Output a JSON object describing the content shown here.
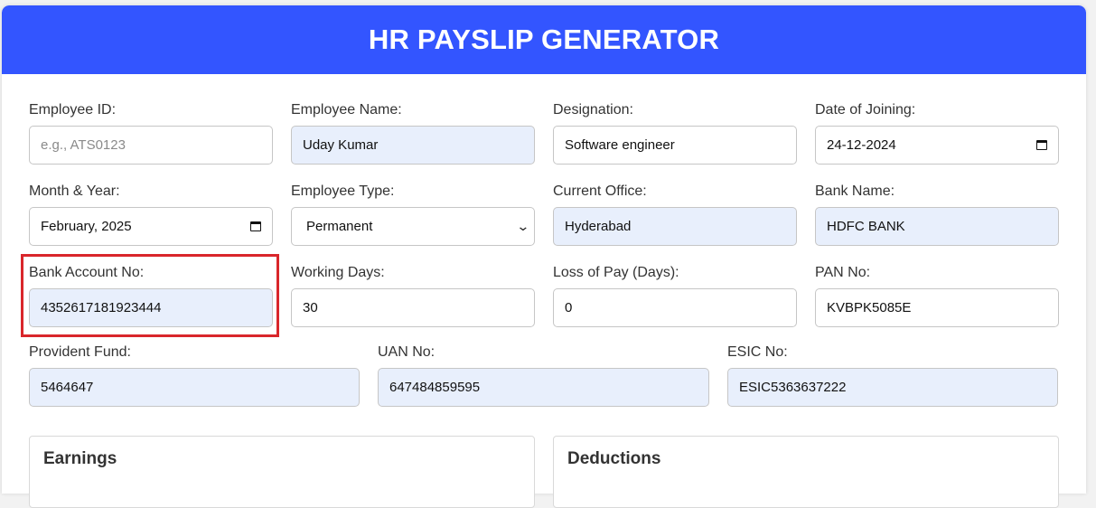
{
  "title": "HR PAYSLIP GENERATOR",
  "fields": {
    "employee_id": {
      "label": "Employee ID:",
      "value": "",
      "placeholder": "e.g., ATS0123"
    },
    "employee_name": {
      "label": "Employee Name:",
      "value": "Uday Kumar"
    },
    "designation": {
      "label": "Designation:",
      "value": "Software engineer"
    },
    "date_of_joining": {
      "label": "Date of Joining:",
      "value": "24-12-2024"
    },
    "month_year": {
      "label": "Month & Year:",
      "value": "February, 2025"
    },
    "employee_type": {
      "label": "Employee Type:",
      "value": "Permanent"
    },
    "current_office": {
      "label": "Current Office:",
      "value": "Hyderabad"
    },
    "bank_name": {
      "label": "Bank Name:",
      "value": "HDFC BANK"
    },
    "bank_account": {
      "label": "Bank Account No:",
      "value": "4352617181923444"
    },
    "working_days": {
      "label": "Working Days:",
      "value": "30"
    },
    "loss_of_pay": {
      "label": "Loss of Pay (Days):",
      "value": "0"
    },
    "pan": {
      "label": "PAN No:",
      "value": "KVBPK5085E"
    },
    "provident_fund": {
      "label": "Provident Fund:",
      "value": "5464647"
    },
    "uan": {
      "label": "UAN No:",
      "value": "647484859595"
    },
    "esic": {
      "label": "ESIC No:",
      "value": "ESIC5363637222"
    }
  },
  "sections": {
    "earnings": "Earnings",
    "deductions": "Deductions"
  },
  "colors": {
    "header": "#3355ff",
    "autofill": "#e8effc",
    "highlight": "#d9262b"
  }
}
